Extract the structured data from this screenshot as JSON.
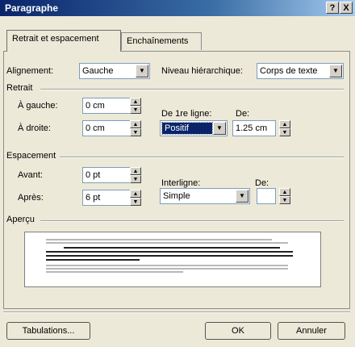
{
  "window": {
    "title": "Paragraphe",
    "help_label": "?",
    "close_label": "X"
  },
  "tabs": [
    {
      "label": "Retrait et espacement",
      "accel": "R"
    },
    {
      "label": "Enchaînements",
      "accel": "c"
    }
  ],
  "alignement": {
    "label": "Alignement:",
    "value": "Gauche"
  },
  "niveau": {
    "label": "Niveau hiérarchique:",
    "value": "Corps de texte"
  },
  "retrait": {
    "group_label": "Retrait",
    "gauche": {
      "label": "À gauche:",
      "value": "0 cm"
    },
    "droite": {
      "label": "À droite:",
      "value": "0 cm"
    },
    "premiere_ligne": {
      "label": "De 1re ligne:",
      "value": "Positif"
    },
    "de": {
      "label": "De:",
      "value": "1.25 cm"
    }
  },
  "espacement": {
    "group_label": "Espacement",
    "avant": {
      "label": "Avant:",
      "value": "0 pt"
    },
    "apres": {
      "label": "Après:",
      "value": "6 pt"
    },
    "interligne": {
      "label": "Interligne:",
      "value": "Simple"
    },
    "de": {
      "label": "De:",
      "value": ""
    }
  },
  "apercu": {
    "group_label": "Aperçu"
  },
  "buttons": {
    "tabulations": "Tabulations...",
    "ok": "OK",
    "annuler": "Annuler"
  },
  "colors": {
    "titlebar_start": "#0a246a",
    "titlebar_end": "#a6caf0",
    "dialog_bg": "#ece9d8",
    "selection": "#0a246a"
  }
}
